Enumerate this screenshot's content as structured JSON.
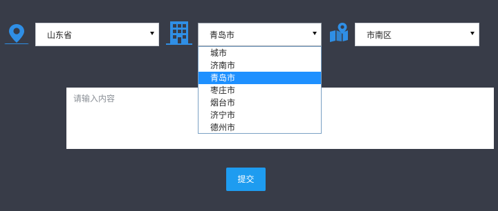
{
  "colors": {
    "background": "#383c48",
    "icon": "#2f8fe6",
    "highlight": "#1e90ff",
    "submit": "#1e9cf0"
  },
  "icons": {
    "province": "map-pin-icon",
    "city": "building-icon",
    "district": "map-marker-icon"
  },
  "province_select": {
    "value": "山东省"
  },
  "city_select": {
    "value": "青岛市",
    "options": [
      "城市",
      "济南市",
      "青岛市",
      "枣庄市",
      "烟台市",
      "济宁市",
      "德州市"
    ],
    "selected_index": 2
  },
  "district_select": {
    "value": "市南区"
  },
  "content": {
    "placeholder": "请输入内容"
  },
  "submit": {
    "label": "提交"
  }
}
